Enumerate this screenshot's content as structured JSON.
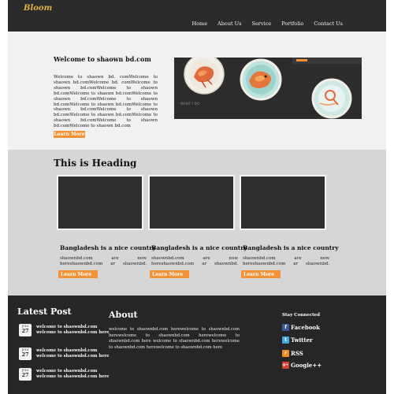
{
  "brand": {
    "logo": "Bloom"
  },
  "nav": {
    "items": [
      "Home",
      "About Us",
      "Service",
      "Portfolio",
      "Contact Us"
    ]
  },
  "hero": {
    "title": "Welcome to shaown bd.com",
    "body": "Welcome to shaown bd. comWelcome to shaown bd.comWelcome bd. comWelcome to shaown bd.comWelcome to shaown bd.comWelcome to shaown bd.comWelcome to shaown bd.comWelcome to shaown bd.comWelcome to shaown bd.comWelcome to shaown bd.comWelcome to shaown bd.comWelcome to shaown bd.comWelcome to shaown bd.comWelcome to shaown bd.comWelcome to shaown bd.com",
    "button": "Learn More",
    "image_caption": "WHAT I DO"
  },
  "features": {
    "heading": "This is Heading",
    "cards": [
      {
        "title": "Bangladesh is a nice country",
        "text": "shaownbd.com are now hereshaownbd.com ar shaownbd.",
        "button": "Learn More"
      },
      {
        "title": "Bangladesh is a nice country",
        "text": "shaownbd.com are now hereshaownbd.com ar shaownbd.",
        "button": "Learn More"
      },
      {
        "title": "Bangladesh is a nice country",
        "text": "shaownbd.com are now hereshaownbd.com ar shaownbd.",
        "button": "Learn More"
      }
    ]
  },
  "footer": {
    "latest_heading": "Latest Post",
    "posts": [
      {
        "month": "JULY",
        "day": "27",
        "text": "welcome to shaownbd.com welcome to shaownbd.com here"
      },
      {
        "month": "JULY",
        "day": "27",
        "text": "welcome to shaownbd.com welcome to shaownbd.com here"
      },
      {
        "month": "JULY",
        "day": "27",
        "text": "welcome to shaownbd.com welcome to shaownbd.com here"
      }
    ],
    "about_heading": "About",
    "about_text": "welcome to shaownbd.com herewelcome to shaownbd.com herewelcome to shaownbd.com herewelcome to shaownbd.com here welcome to shaownbd.com herewelcome to shaownbd.com herewelcome to shaownbd.com here",
    "stay_heading": "Stay Connected",
    "social": [
      {
        "label": "Facebook",
        "icon": "facebook-icon",
        "glyph": "f",
        "color": "#3b5998"
      },
      {
        "label": "Twitter",
        "icon": "twitter-icon",
        "glyph": "t",
        "color": "#3fa9e0"
      },
      {
        "label": "RSS",
        "icon": "rss-icon",
        "glyph": "r",
        "color": "#f08a24"
      },
      {
        "label": "Google++",
        "icon": "google-plus-icon",
        "glyph": "g+",
        "color": "#d2412f"
      }
    ]
  },
  "colors": {
    "accent": "#f39236",
    "header": "#2b2b2b",
    "footer": "#262626",
    "logo": "#e2b23c"
  }
}
